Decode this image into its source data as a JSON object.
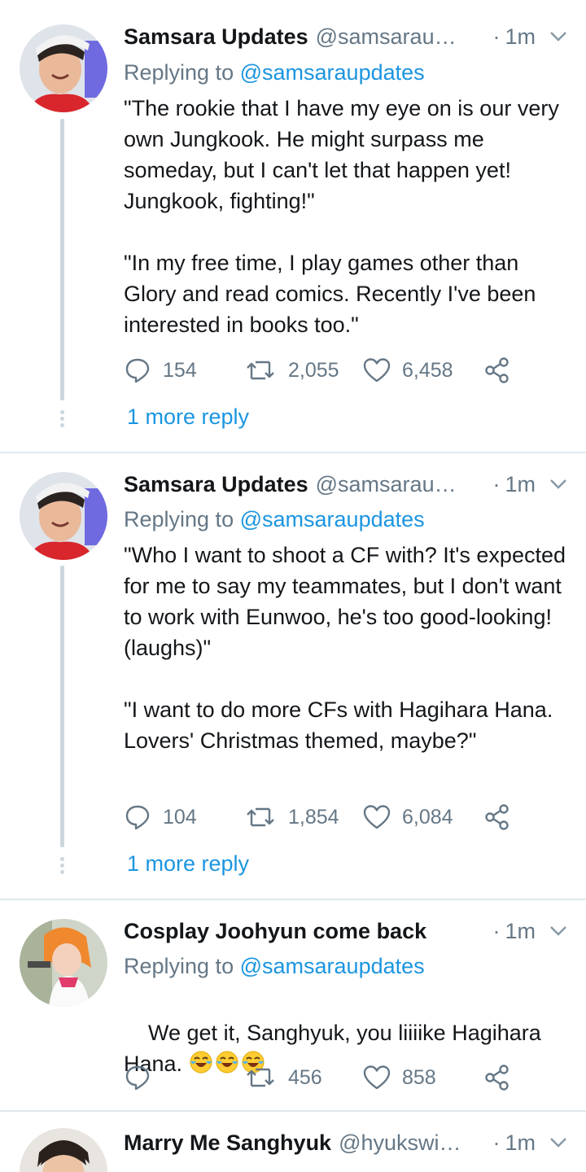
{
  "tweets": [
    {
      "name": "Samsara Updates",
      "handle": "@samsarau…",
      "time": "1m",
      "replying_prefix": "Replying to",
      "replying_to": "@samsaraupdates",
      "text": "\"The rookie that I have my eye on is our very own Jungkook. He might surpass me someday, but I can't let that happen yet! Jungkook, fighting!\"\n\n\"In my free time, I play games other than Glory and read comics. Recently I've been interested in books too.\"",
      "replies": "154",
      "retweets": "2,055",
      "likes": "6,458",
      "more_reply": "1 more reply"
    },
    {
      "name": "Samsara Updates",
      "handle": "@samsarau…",
      "time": "1m",
      "replying_prefix": "Replying to",
      "replying_to": "@samsaraupdates",
      "text": "\"Who I want to shoot a CF with? It's expected for me to say my teammates, but I don't want to work with Eunwoo, he's too good-looking! (laughs)\"\n\n\"I want to do more CFs with Hagihara Hana. Lovers' Christmas themed, maybe?\"",
      "replies": "104",
      "retweets": "1,854",
      "likes": "6,084",
      "more_reply": "1 more reply"
    },
    {
      "name": "Cosplay Joohyun come back",
      "handle": "",
      "time": "1m",
      "replying_prefix": "Replying to",
      "replying_to": "@samsaraupdates",
      "text": "We get it, Sanghyuk, you liiiike Hagihara Hana. ",
      "emoji": "face-with-tears-of-joy",
      "replies": "",
      "retweets": "456",
      "likes": "858"
    },
    {
      "name": "Marry Me Sanghyuk",
      "handle": "@hyukswi…",
      "time": "1m"
    }
  ],
  "colors": {
    "link": "#1b95e0",
    "secondary_text": "#657786",
    "divider": "#e1e8ed"
  },
  "icons": [
    "reply-icon",
    "retweet-icon",
    "like-icon",
    "share-icon",
    "chevron-down-icon"
  ]
}
